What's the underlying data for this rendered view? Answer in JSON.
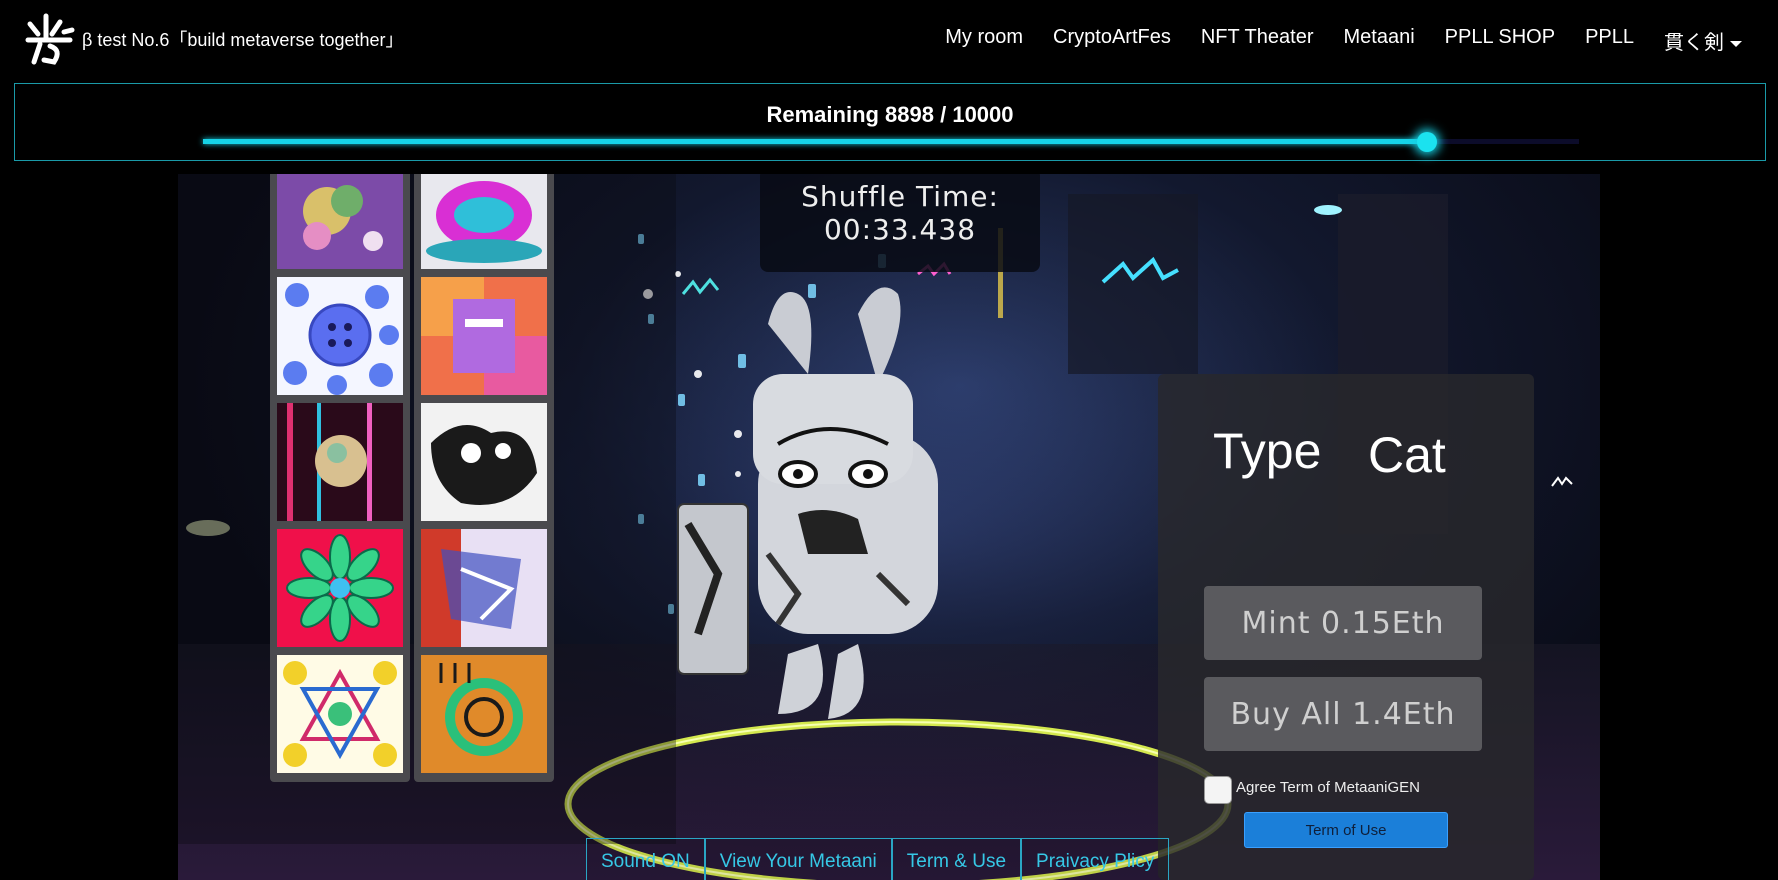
{
  "navbar": {
    "brand_text": "β test No.6「build metaverse together」",
    "links": [
      "My room",
      "CryptoArtFes",
      "NFT Theater",
      "Metaani",
      "PPLL SHOP",
      "PPLL",
      "貫く剣"
    ]
  },
  "progress": {
    "label": "Remaining 8898 / 10000",
    "remaining": 8898,
    "total": 10000,
    "fill_fraction": 0.8898
  },
  "shuffle": {
    "label": "Shuffle Time:",
    "time": "00:33.438"
  },
  "info_panel": {
    "type_label": "Type",
    "type_value": "Cat",
    "mint_label": "Mint 0.15Eth",
    "buy_all_label": "Buy All 1.4Eth",
    "agree_label": "Agree Term of MetaaniGEN",
    "agree_checked": false,
    "term_button_label": "Term of Use"
  },
  "bottom_links": [
    "Sound ON",
    "View Your Metaani",
    "Term & Use",
    "Praivacy Plicy"
  ],
  "colors": {
    "accent": "#16d4e8",
    "panel": "#28282c",
    "button": "#5a5a5e",
    "term_button": "#1b7fd9",
    "link": "#36c8e6"
  },
  "icons": {
    "logo": "kanji-logo-icon",
    "nav_dropdown": "caret-down-icon"
  }
}
